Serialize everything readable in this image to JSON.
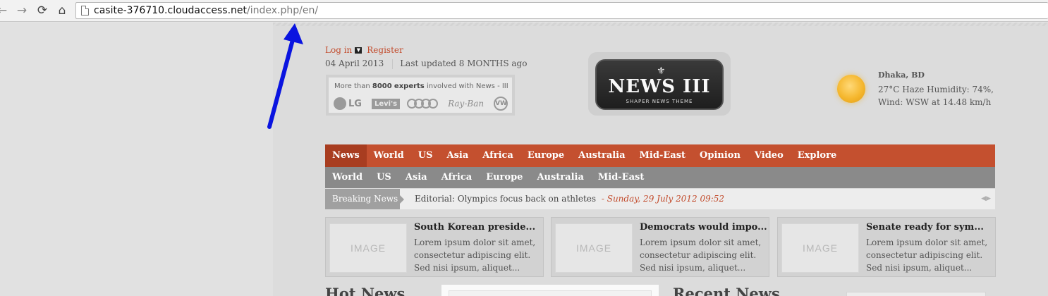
{
  "browser": {
    "back_icon": "back-arrow-icon",
    "forward_icon": "forward-arrow-icon",
    "reload_icon": "reload-icon",
    "home_icon": "home-icon",
    "url_host": "casite-376710.cloudaccess.net",
    "url_path": "/index.php/en/"
  },
  "header": {
    "login_label": "Log in",
    "register_label": "Register",
    "date": "04 April 2013",
    "last_updated": "Last updated 8 MONTHS ago",
    "partners": {
      "prefix": "More than",
      "count": "8000",
      "experts": "experts",
      "suffix": "involved with News - III",
      "logos": {
        "lg": "LG",
        "levis": "Levi's",
        "rayban": "Ray-Ban",
        "vw": "VW"
      }
    },
    "logo": {
      "title": "NEWS III",
      "subtitle": "SHAPER NEWS THEME"
    },
    "weather": {
      "icon": "sun-icon",
      "city": "Dhaka, BD",
      "line1": "27°C Haze Humidity: 74%,",
      "line2": "Wind: WSW at 14.48 km/h"
    }
  },
  "main_nav": {
    "items": [
      "News",
      "World",
      "US",
      "Asia",
      "Africa",
      "Europe",
      "Australia",
      "Mid-East",
      "Opinion",
      "Video",
      "Explore"
    ],
    "active": "News"
  },
  "sub_nav": {
    "items": [
      "World",
      "US",
      "Asia",
      "Africa",
      "Europe",
      "Australia",
      "Mid-East"
    ]
  },
  "breaking": {
    "label": "Breaking News",
    "headline": "Editorial: Olympics focus back on athletes",
    "date": "- Sunday, 29 July 2012 09:52"
  },
  "featured": [
    {
      "image_label": "IMAGE",
      "title": "South Korean preside...",
      "body": "Lorem ipsum dolor sit amet, consectetur adipiscing elit. Sed nisi ipsum, aliquet..."
    },
    {
      "image_label": "IMAGE",
      "title": "Democrats would impo...",
      "body": "Lorem ipsum dolor sit amet, consectetur adipiscing elit. Sed nisi ipsum, aliquet..."
    },
    {
      "image_label": "IMAGE",
      "title": "Senate ready for sym...",
      "body": "Lorem ipsum dolor sit amet, consectetur adipiscing elit. Sed nisi ipsum, aliquet..."
    }
  ],
  "sections": {
    "hot_news": "Hot News",
    "recent_news": "Recent News"
  },
  "colors": {
    "accent": "#c4502f",
    "subnav": "#8a8a8a",
    "annotation_arrow": "#0a14e0"
  }
}
